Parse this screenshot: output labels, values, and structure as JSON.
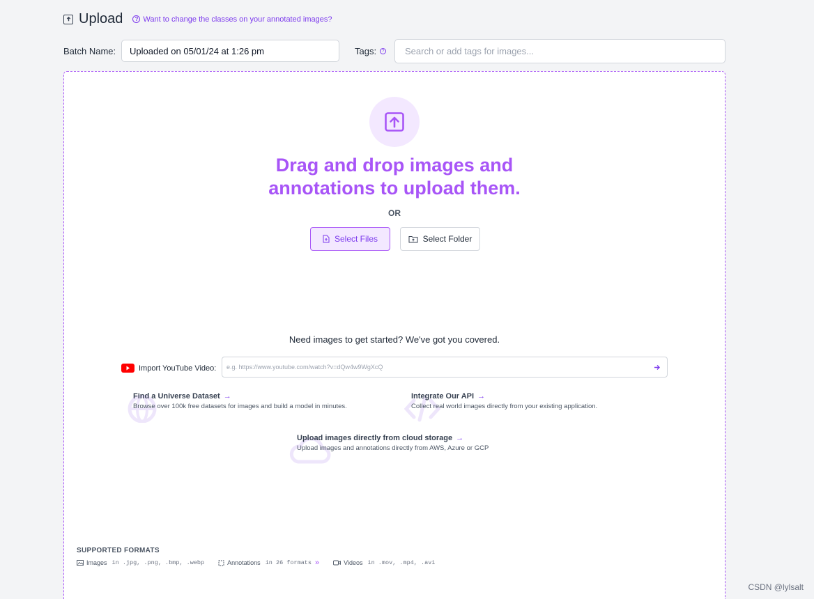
{
  "header": {
    "title": "Upload",
    "help_link": "Want to change the classes on your annotated images?"
  },
  "batch": {
    "label": "Batch Name:",
    "value": "Uploaded on 05/01/24 at 1:26 pm"
  },
  "tags": {
    "label": "Tags:",
    "placeholder": "Search or add tags for images..."
  },
  "dropzone": {
    "heading_line1": "Drag and drop images and",
    "heading_line2": "annotations to upload them.",
    "or": "OR",
    "select_files": "Select Files",
    "select_folder": "Select Folder"
  },
  "getting_started": {
    "heading": "Need images to get started? We've got you covered.",
    "youtube_label": "Import YouTube Video:",
    "youtube_placeholder": "e.g. https://www.youtube.com/watch?v=dQw4w9WgXcQ",
    "resources": [
      {
        "title": "Find a Universe Dataset",
        "desc": "Browse over 100k free datasets for images and build a model in minutes."
      },
      {
        "title": "Integrate Our API",
        "desc": "Collect real world images directly from your existing application."
      },
      {
        "title": "Upload images directly from cloud storage",
        "desc": "Upload images and annotations directly from AWS, Azure or GCP"
      }
    ]
  },
  "formats": {
    "heading": "SUPPORTED FORMATS",
    "images_label": "Images",
    "images_formats": "in .jpg, .png, .bmp, .webp",
    "annotations_label": "Annotations",
    "annotations_formats": "in 26 formats",
    "videos_label": "Videos",
    "videos_formats": "in .mov, .mp4, .avi"
  },
  "watermark": "CSDN @lylsalt",
  "colors": {
    "accent": "#a855f7",
    "accent_dark": "#7c3aed",
    "accent_light": "#f3e8ff",
    "youtube": "#ff0000"
  }
}
